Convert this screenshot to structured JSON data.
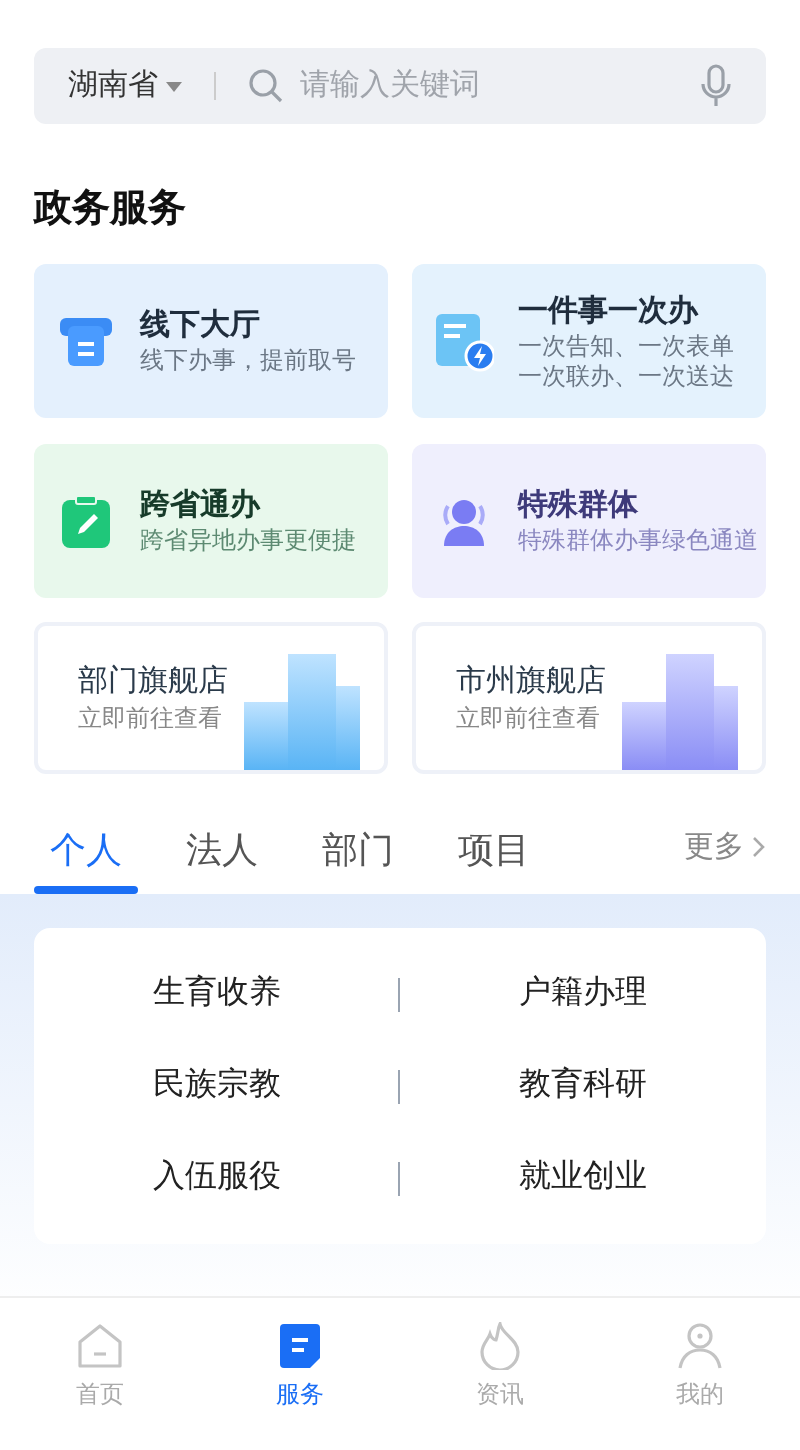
{
  "search": {
    "region": "湖南省",
    "placeholder": "请输入关键词"
  },
  "section_title": "政务服务",
  "services": [
    {
      "kind": "hall",
      "title": "线下大厅",
      "subtitle": [
        "线下办事，提前取号"
      ]
    },
    {
      "kind": "once",
      "title": "一件事一次办",
      "subtitle": [
        "一次告知、一次表单",
        "一次联办、一次送达"
      ]
    },
    {
      "kind": "cross",
      "title": "跨省通办",
      "subtitle": [
        "跨省异地办事更便捷"
      ]
    },
    {
      "kind": "special",
      "title": "特殊群体",
      "subtitle": [
        "特殊群体办事绿色通道"
      ]
    }
  ],
  "stores": [
    {
      "kind": "blue",
      "title": "部门旗舰店",
      "subtitle": "立即前往查看"
    },
    {
      "kind": "purple",
      "title": "市州旗舰店",
      "subtitle": "立即前往查看"
    }
  ],
  "tabs": [
    {
      "label": "个人",
      "selected": true
    },
    {
      "label": "法人",
      "selected": false
    },
    {
      "label": "部门",
      "selected": false
    },
    {
      "label": "项目",
      "selected": false
    }
  ],
  "more": "更多",
  "categories": [
    "生育收养",
    "户籍办理",
    "民族宗教",
    "教育科研",
    "入伍服役",
    "就业创业"
  ],
  "nav": [
    {
      "kind": "home",
      "label": "首页",
      "selected": false
    },
    {
      "kind": "service",
      "label": "服务",
      "selected": true
    },
    {
      "kind": "news",
      "label": "资讯",
      "selected": false
    },
    {
      "kind": "me",
      "label": "我的",
      "selected": false
    }
  ]
}
